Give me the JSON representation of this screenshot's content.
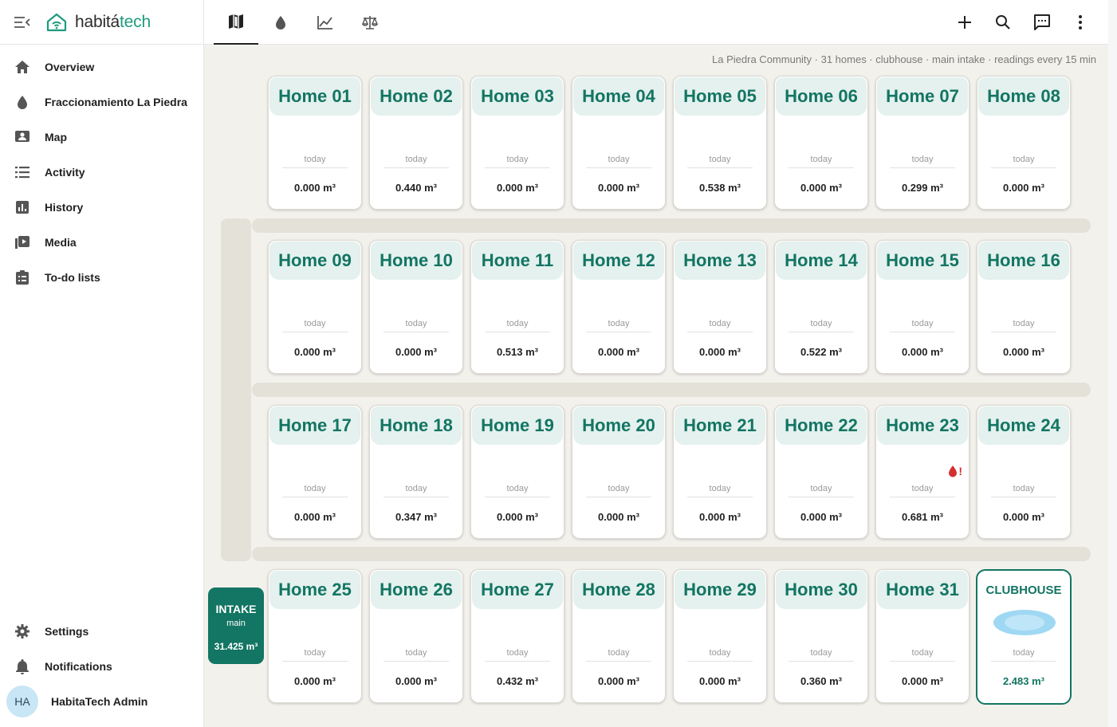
{
  "brand": {
    "name_part1": "habitá",
    "name_part2": "tech",
    "accent": "#1f9b7f"
  },
  "sidebar": {
    "items": [
      {
        "label": "Overview",
        "icon": "home-icon"
      },
      {
        "label": "Fraccionamiento La Piedra",
        "icon": "water-drop-icon"
      },
      {
        "label": "Map",
        "icon": "map-person-icon"
      },
      {
        "label": "Activity",
        "icon": "list-icon"
      },
      {
        "label": "History",
        "icon": "chart-icon"
      },
      {
        "label": "Media",
        "icon": "media-icon"
      },
      {
        "label": "To-do lists",
        "icon": "clipboard-icon"
      }
    ],
    "bottom": [
      {
        "label": "Settings",
        "icon": "gear-icon"
      },
      {
        "label": "Notifications",
        "icon": "bell-icon"
      }
    ],
    "user": {
      "initials": "HA",
      "name": "HabitaTech Admin"
    }
  },
  "toolbar": {
    "tabs": [
      {
        "icon": "map-icon",
        "active": true
      },
      {
        "icon": "water-drop-icon",
        "active": false
      },
      {
        "icon": "line-chart-icon",
        "active": false
      },
      {
        "icon": "scale-icon",
        "active": false
      }
    ],
    "actions": [
      "add-icon",
      "search-icon",
      "chat-icon",
      "more-vert-icon"
    ]
  },
  "info_line": "La Piedra Community · 31 homes · clubhouse · main intake · readings every 15 min",
  "today_label": "today",
  "homes": [
    {
      "name": "Home 01",
      "value": "0.000 m³"
    },
    {
      "name": "Home 02",
      "value": "0.440 m³"
    },
    {
      "name": "Home 03",
      "value": "0.000 m³"
    },
    {
      "name": "Home 04",
      "value": "0.000 m³"
    },
    {
      "name": "Home 05",
      "value": "0.538 m³"
    },
    {
      "name": "Home 06",
      "value": "0.000 m³"
    },
    {
      "name": "Home 07",
      "value": "0.299 m³"
    },
    {
      "name": "Home 08",
      "value": "0.000 m³"
    },
    {
      "name": "Home 09",
      "value": "0.000 m³"
    },
    {
      "name": "Home 10",
      "value": "0.000 m³"
    },
    {
      "name": "Home 11",
      "value": "0.513 m³"
    },
    {
      "name": "Home 12",
      "value": "0.000 m³"
    },
    {
      "name": "Home 13",
      "value": "0.000 m³"
    },
    {
      "name": "Home 14",
      "value": "0.522 m³"
    },
    {
      "name": "Home 15",
      "value": "0.000 m³"
    },
    {
      "name": "Home 16",
      "value": "0.000 m³"
    },
    {
      "name": "Home 17",
      "value": "0.000 m³"
    },
    {
      "name": "Home 18",
      "value": "0.347 m³"
    },
    {
      "name": "Home 19",
      "value": "0.000 m³"
    },
    {
      "name": "Home 20",
      "value": "0.000 m³"
    },
    {
      "name": "Home 21",
      "value": "0.000 m³"
    },
    {
      "name": "Home 22",
      "value": "0.000 m³"
    },
    {
      "name": "Home 23",
      "value": "0.681 m³",
      "leak": true,
      "leak_mark": "!"
    },
    {
      "name": "Home 24",
      "value": "0.000 m³"
    },
    {
      "name": "Home 25",
      "value": "0.000 m³"
    },
    {
      "name": "Home 26",
      "value": "0.000 m³"
    },
    {
      "name": "Home 27",
      "value": "0.432 m³"
    },
    {
      "name": "Home 28",
      "value": "0.000 m³"
    },
    {
      "name": "Home 29",
      "value": "0.000 m³"
    },
    {
      "name": "Home 30",
      "value": "0.360 m³"
    },
    {
      "name": "Home 31",
      "value": "0.000 m³"
    }
  ],
  "clubhouse": {
    "name": "CLUBHOUSE",
    "value": "2.483 m³"
  },
  "intake": {
    "name": "INTAKE",
    "sub": "main",
    "value": "31.425 m³"
  },
  "colors": {
    "card_title": "#137563",
    "title_bg": "#e4f1ee",
    "road": "#e4e1d8",
    "leak": "#d32f2f",
    "pool": "#9fd8f3"
  }
}
